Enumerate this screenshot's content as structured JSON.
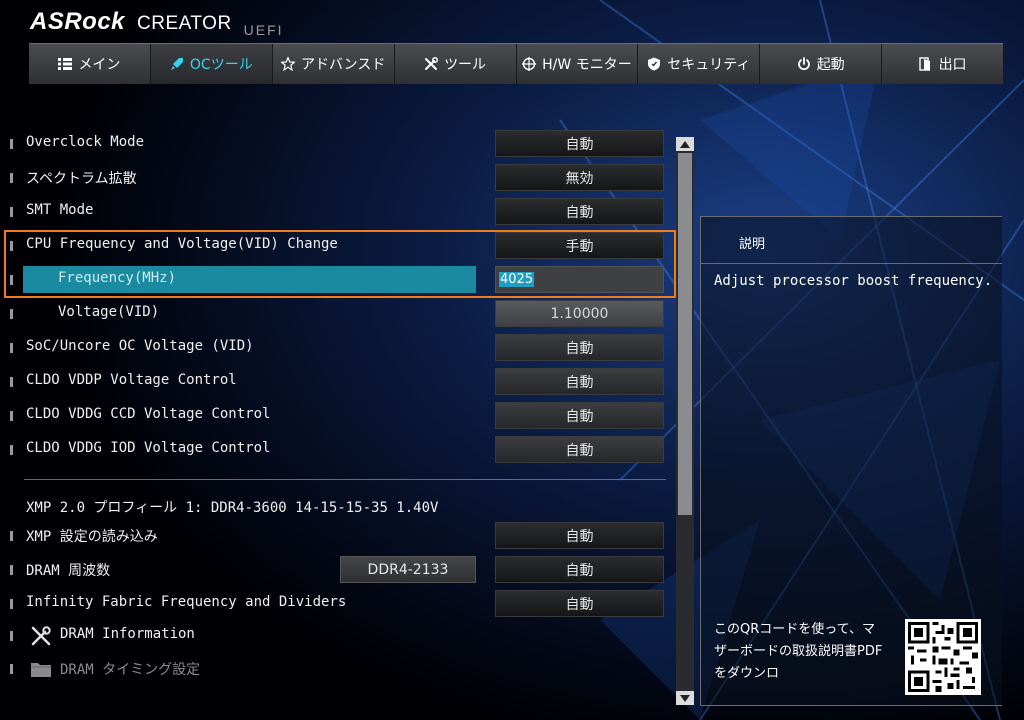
{
  "brand": {
    "logo": "ASRock",
    "product": "CREATOR",
    "uefi": "UEFI"
  },
  "tabs": [
    {
      "label": "メイン",
      "icon": "list-icon",
      "active": false
    },
    {
      "label": "OCツール",
      "icon": "rocket-icon",
      "active": true
    },
    {
      "label": "アドバンスド",
      "icon": "star-icon",
      "active": false
    },
    {
      "label": "ツール",
      "icon": "tools-icon",
      "active": false
    },
    {
      "label": "H/W モニター",
      "icon": "crosshair-icon",
      "active": false
    },
    {
      "label": "セキュリティ",
      "icon": "shield-icon",
      "active": false
    },
    {
      "label": "起動",
      "icon": "power-icon",
      "active": false
    },
    {
      "label": "出口",
      "icon": "exit-icon",
      "active": false
    }
  ],
  "settings": {
    "overclock_mode": {
      "label": "Overclock Mode",
      "value": "自動"
    },
    "spread_spectrum": {
      "label": "スペクトラム拡散",
      "value": "無効"
    },
    "smt_mode": {
      "label": "SMT Mode",
      "value": "自動"
    },
    "cpu_freq_voltage": {
      "label": "CPU Frequency and Voltage(VID) Change",
      "value": "手動"
    },
    "frequency": {
      "label": "Frequency(MHz)",
      "value": "4025"
    },
    "voltage": {
      "label": "Voltage(VID)",
      "value": "1.10000"
    },
    "soc_uncore": {
      "label": "SoC/Uncore OC Voltage (VID)",
      "value": "自動"
    },
    "cldo_vddp": {
      "label": "CLDO VDDP Voltage Control",
      "value": "自動"
    },
    "cldo_vddg_ccd": {
      "label": "CLDO VDDG CCD Voltage Control",
      "value": "自動"
    },
    "cldo_vddg_iod": {
      "label": "CLDO VDDG IOD Voltage Control",
      "value": "自動"
    },
    "xmp_profile": "XMP 2.0 プロフィール 1: DDR4-3600 14-15-15-35 1.40V",
    "xmp_load": {
      "label": "XMP 設定の読み込み",
      "value": "自動"
    },
    "dram_freq": {
      "label": "DRAM 周波数",
      "badge": "DDR4-2133",
      "value": "自動"
    },
    "infinity_fabric": {
      "label": "Infinity Fabric Frequency and Dividers",
      "value": "自動"
    },
    "dram_info": {
      "label": "DRAM Information"
    },
    "dram_timing": {
      "label": "DRAM タイミング設定"
    }
  },
  "description": {
    "title": "説明",
    "text": "Adjust processor boost frequency.",
    "qr_note": "このQRコードを使って、マザーボードの取扱説明書PDFをダウンロ"
  },
  "colors": {
    "accent": "#37d3f0",
    "selected_row": "#1a8aa0",
    "highlight_box": "#f07c1f"
  }
}
